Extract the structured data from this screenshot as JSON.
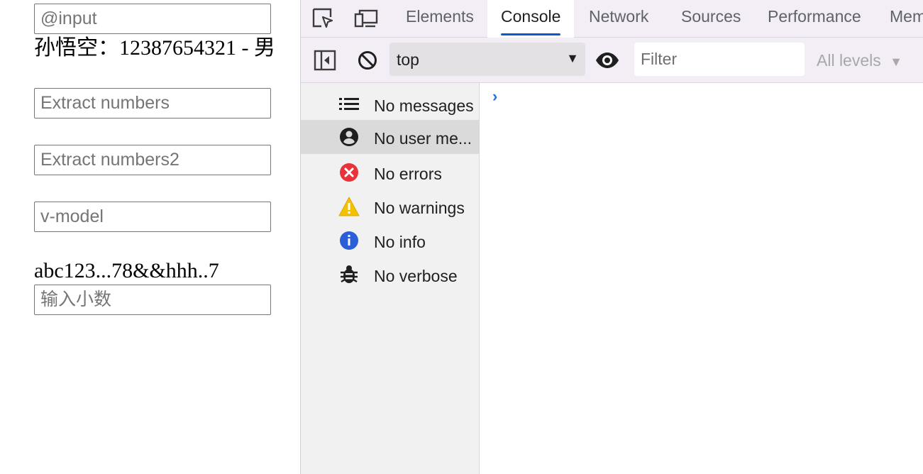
{
  "page": {
    "input_at_placeholder": "@input",
    "info_line": "孙悟空：12387654321 - 男",
    "extract_placeholder": "Extract numbers",
    "extract2_placeholder": "Extract numbers2",
    "vmodel_placeholder": "v-model",
    "mixed_text": "abc123...78&&hhh..7",
    "decimal_placeholder": "输入小数"
  },
  "devtools": {
    "tabs": [
      "Elements",
      "Console",
      "Network",
      "Sources",
      "Performance",
      "Mem"
    ],
    "active_tab": "Console",
    "toolbar": {
      "context_value": "top",
      "filter_placeholder": "Filter",
      "levels_label": "All levels"
    },
    "sidebar": [
      {
        "label": "No messages",
        "icon": "list-icon"
      },
      {
        "label": "No user me...",
        "icon": "user-icon",
        "selected": true
      },
      {
        "label": "No errors",
        "icon": "error-icon"
      },
      {
        "label": "No warnings",
        "icon": "warning-icon"
      },
      {
        "label": "No info",
        "icon": "info-icon"
      },
      {
        "label": "No verbose",
        "icon": "bug-icon"
      }
    ],
    "prompt_symbol": "›"
  },
  "colors": {
    "accent": "#0b57d0",
    "error": "#e8333a",
    "warning": "#f2c200",
    "info": "#2b5fd8",
    "prompt": "#1a73e8"
  }
}
